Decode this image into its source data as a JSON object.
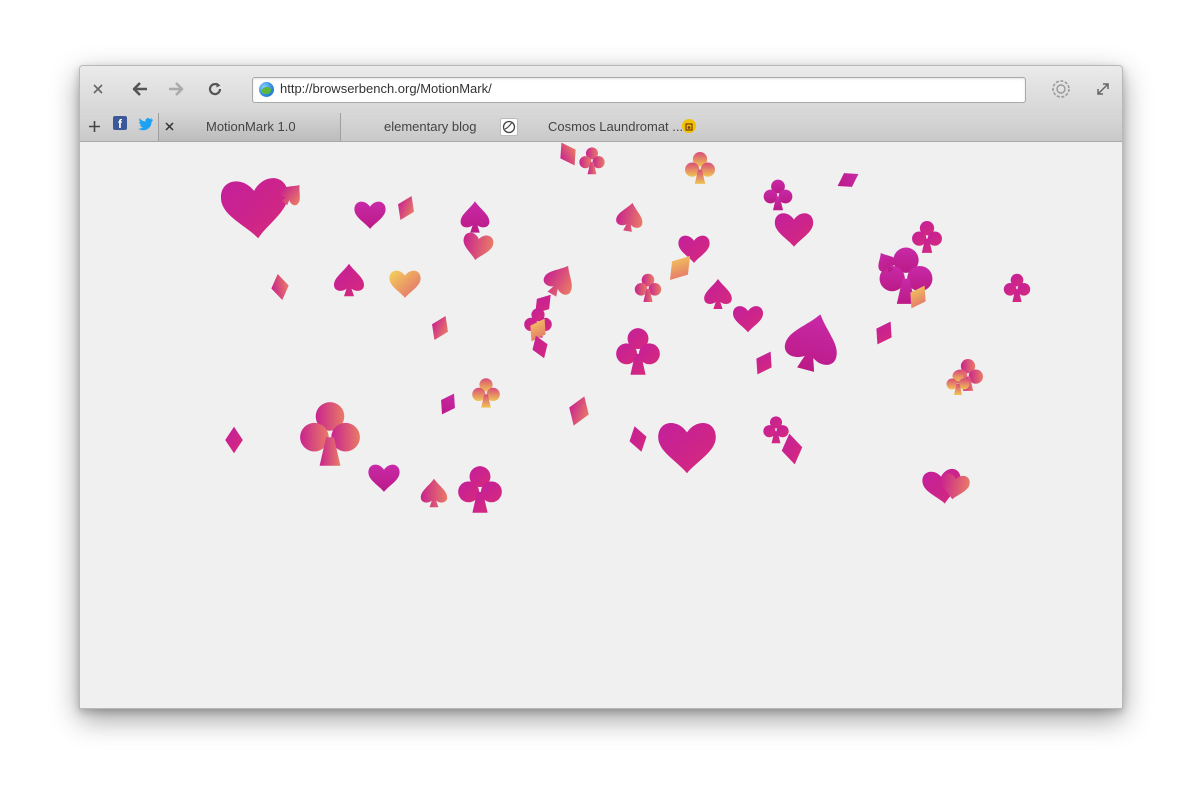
{
  "browser": {
    "url": "http://browserbench.org/MotionMark/",
    "tabs": [
      {
        "label": "MotionMark 1.0",
        "active": true
      },
      {
        "label": "elementary blog",
        "active": false
      },
      {
        "label": "Cosmos Laundromat ...",
        "active": false
      }
    ],
    "icons": {
      "close": "close-icon",
      "back": "back-arrow-icon",
      "forward": "forward-arrow-icon",
      "reload": "reload-icon",
      "settings": "gear-icon",
      "fullscreen": "fullscreen-icon",
      "new_tab": "plus-icon",
      "facebook": "facebook-icon",
      "twitter": "twitter-icon"
    }
  },
  "colors": {
    "magenta": "#c81e9a",
    "pink": "#d63a7c",
    "orange": "#e8836a",
    "yellow": "#f0c85a"
  }
}
